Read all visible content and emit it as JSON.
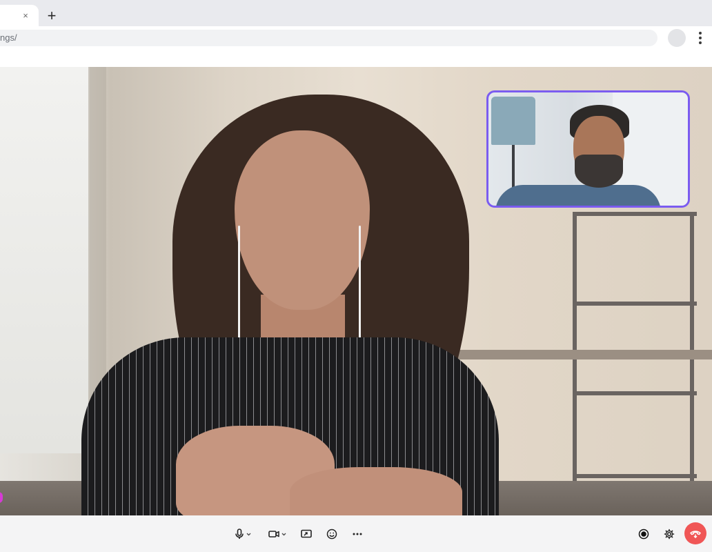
{
  "browser": {
    "tab": {
      "close_label": "×"
    },
    "new_tab_label": "+",
    "address_bar": {
      "url": "ngs/"
    }
  },
  "call": {
    "main_participant": {
      "camera": "on"
    },
    "self_view": {
      "camera": "on",
      "border_color": "#7b5cf0"
    }
  },
  "controls": {
    "icons": [
      "microphone-icon",
      "camera-icon",
      "share-screen-icon",
      "emoji-icon",
      "more-options-icon",
      "record-icon",
      "settings-icon",
      "leave-call-icon"
    ],
    "leave_color": "#f05656"
  }
}
